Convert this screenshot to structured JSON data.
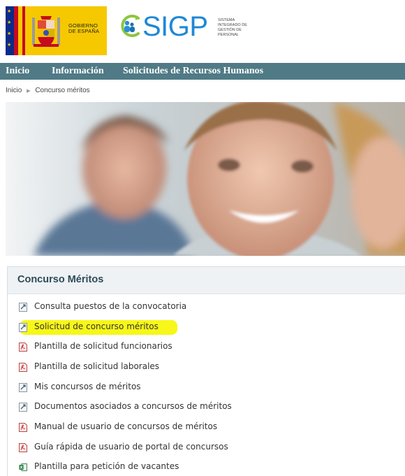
{
  "gov": {
    "line1": "GOBIERNO",
    "line2": "DE ESPAÑA"
  },
  "sigp": {
    "word": "SIGP",
    "sub": [
      "SISTEMA",
      "INTEGRADO DE",
      "GESTIÓN DE",
      "PERSONAL"
    ]
  },
  "nav": [
    "Inicio",
    "Información",
    "Solicitudes de Recursos Humanos"
  ],
  "breadcrumb": {
    "home": "Inicio",
    "current": "Concurso méritos"
  },
  "panel": {
    "title": "Concurso Méritos",
    "links": [
      {
        "label": "Consulta puestos de la convocatoria",
        "icon": "web-page-icon"
      },
      {
        "label": "Solicitud de concurso méritos",
        "icon": "web-page-icon",
        "highlighted": true
      },
      {
        "label": "Plantilla de solicitud funcionarios",
        "icon": "pdf-icon"
      },
      {
        "label": "Plantilla de solicitud laborales",
        "icon": "pdf-icon"
      },
      {
        "label": "Mis concursos de méritos",
        "icon": "web-page-icon"
      },
      {
        "label": "Documentos asociados a concursos de méritos",
        "icon": "web-page-icon"
      },
      {
        "label": "Manual de usuario de concursos de méritos",
        "icon": "pdf-icon"
      },
      {
        "label": "Guía rápida de usuario de portal de concursos",
        "icon": "pdf-icon"
      },
      {
        "label": "Plantilla para petición de vacantes",
        "icon": "excel-icon"
      }
    ]
  },
  "colors": {
    "nav_bg": "#4f7a86",
    "gov_yellow": "#f6c800",
    "sigp_blue": "#1e88d6",
    "highlight": "#f6f600"
  }
}
